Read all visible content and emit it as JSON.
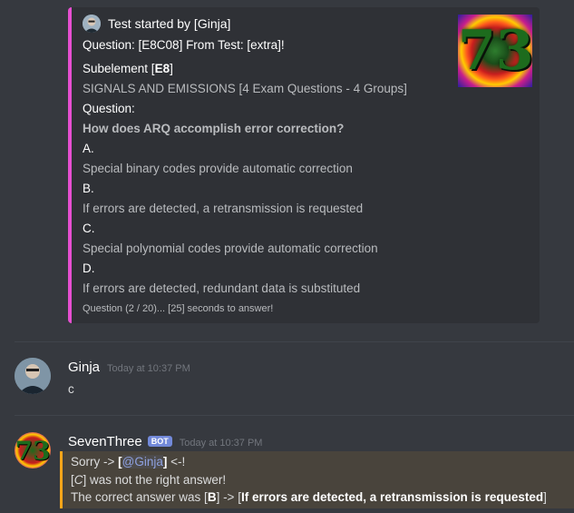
{
  "embed": {
    "author": "Test started by [Ginja]",
    "question_header": "Question: [E8C08] From Test: [extra]!",
    "subelement_prefix": "Subelement [",
    "subelement_code": "E8",
    "subelement_suffix": "]",
    "subelement_desc": "SIGNALS AND EMISSIONS [4 Exam Questions - 4 Groups]",
    "question_label": "Question:",
    "question_text": "How does ARQ accomplish error correction?",
    "options": [
      {
        "letter": "A.",
        "text": "Special binary codes provide automatic correction"
      },
      {
        "letter": "B.",
        "text": "If errors are detected, a retransmission is requested"
      },
      {
        "letter": "C.",
        "text": "Special polynomial codes provide automatic correction"
      },
      {
        "letter": "D.",
        "text": "If errors are detected, redundant data is substituted"
      }
    ],
    "footer": "Question (2 / 20)... [25] seconds to answer!",
    "thumbnail_text": "73",
    "accent_color": "#e64fd1"
  },
  "messages": [
    {
      "username": "Ginja",
      "timestamp": "Today at 10:37 PM",
      "text": "c"
    },
    {
      "username": "SevenThree",
      "bot_badge": "BOT",
      "avatar_text": "73",
      "timestamp": "Today at 10:37 PM",
      "line1_prefix": "Sorry -> ",
      "line1_bracket_open": "[",
      "line1_mention": "@Ginja",
      "line1_bracket_close": "]",
      "line1_suffix": " <-!",
      "line2_prefix": "[",
      "line2_answer": "C",
      "line2_suffix": "] was not the right answer!",
      "line3_prefix": "The correct answer was [",
      "line3_letter": "B",
      "line3_mid": "] -> [",
      "line3_answer": "If errors are detected, a retransmission is requested",
      "line3_suffix": "]"
    }
  ]
}
